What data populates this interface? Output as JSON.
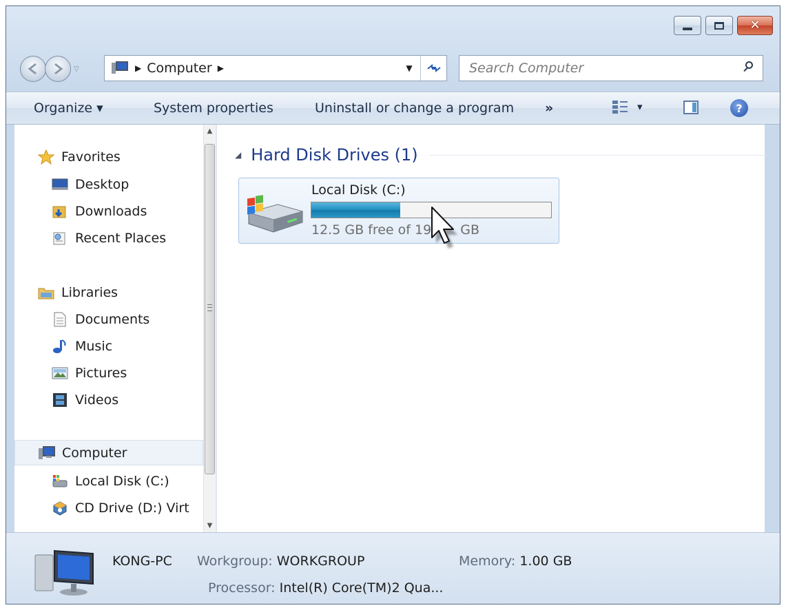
{
  "window": {
    "caption_buttons": {
      "minimize_icon": "minimize-icon",
      "maximize_icon": "maximize-icon",
      "close_glyph": "✕"
    }
  },
  "address": {
    "location": "Computer",
    "separator_glyph": "▶",
    "dropdown_glyph": "▼",
    "refresh_glyph": "↻"
  },
  "search": {
    "placeholder": "Search Computer"
  },
  "toolbar": {
    "organize": "Organize ▾",
    "system_properties": "System properties",
    "uninstall": "Uninstall or change a program",
    "more": "»",
    "view_dropdown": "▾",
    "help": "?"
  },
  "nav": {
    "favorites": {
      "label": "Favorites",
      "items": [
        "Desktop",
        "Downloads",
        "Recent Places"
      ]
    },
    "libraries": {
      "label": "Libraries",
      "items": [
        "Documents",
        "Music",
        "Pictures",
        "Videos"
      ]
    },
    "computer": {
      "label": "Computer",
      "items": [
        "Local Disk (C:)",
        "CD Drive (D:) Virt"
      ]
    }
  },
  "content": {
    "group_title": "Hard Disk Drives (1)",
    "group_arrow": "◢",
    "drive": {
      "name": "Local Disk (C:)",
      "free_text": "12.5 GB free of 19.",
      "free_text_tail": "GB",
      "used_fraction": 0.37
    }
  },
  "details": {
    "computer_name": "KONG-PC",
    "workgroup_label": "Workgroup:",
    "workgroup_value": "WORKGROUP",
    "memory_label": "Memory:",
    "memory_value": "1.00 GB",
    "processor_label": "Processor:",
    "processor_value": "Intel(R) Core(TM)2 Qua..."
  },
  "colors": {
    "accent": "#1e3a8a",
    "progress": "#1f8fc2"
  }
}
